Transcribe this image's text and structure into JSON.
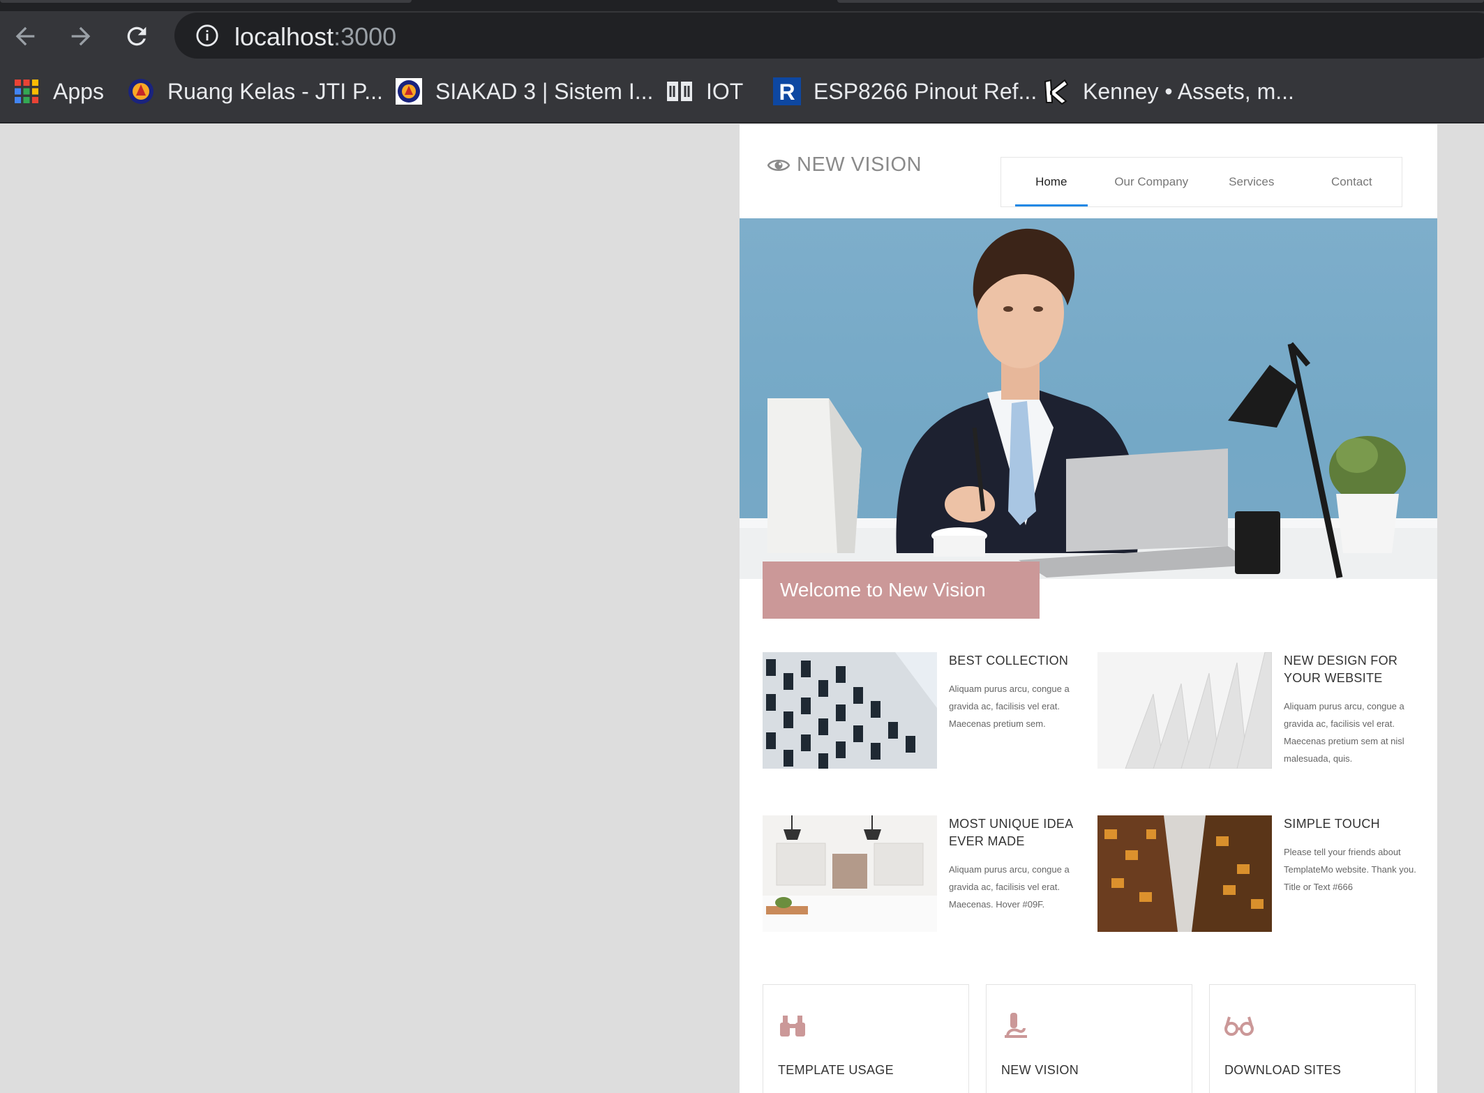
{
  "browser": {
    "url_host": "localhost",
    "url_port": ":3000",
    "bookmarks": [
      {
        "label": "Apps",
        "icon": "apps-grid-icon"
      },
      {
        "label": "Ruang Kelas - JTI P...",
        "icon": "university-emblem-icon"
      },
      {
        "label": "SIAKAD 3 | Sistem I...",
        "icon": "university-emblem-icon"
      },
      {
        "label": "IOT",
        "icon": "book-icon"
      },
      {
        "label": "ESP8266 Pinout Ref...",
        "icon": "r-letter-icon"
      },
      {
        "label": "Kenney • Assets, m...",
        "icon": "kenney-k-icon"
      }
    ]
  },
  "site": {
    "brand": "NEW VISION",
    "nav": [
      {
        "label": "Home",
        "active": true
      },
      {
        "label": "Our Company",
        "active": false
      },
      {
        "label": "Services",
        "active": false
      },
      {
        "label": "Contact",
        "active": false
      }
    ],
    "hero_caption": "Welcome to New Vision",
    "features": [
      {
        "title": "BEST COLLECTION",
        "text": "Aliquam purus arcu, congue a gravida ac, facilisis vel erat. Maecenas pretium sem."
      },
      {
        "title": "NEW DESIGN FOR YOUR WEBSITE",
        "text": "Aliquam purus arcu, congue a gravida ac, facilisis vel erat. Maecenas pretium sem at nisl malesuada, quis."
      },
      {
        "title": "MOST UNIQUE IDEA EVER MADE",
        "text": "Aliquam purus arcu, congue a gravida ac, facilisis vel erat. Maecenas. Hover #09F."
      },
      {
        "title": "SIMPLE TOUCH",
        "text": "Please tell your friends about TemplateMo website. Thank you. Title or Text #666"
      }
    ],
    "cards": [
      {
        "title": "TEMPLATE USAGE",
        "icon": "binoculars-icon"
      },
      {
        "title": "NEW VISION",
        "icon": "microscope-icon"
      },
      {
        "title": "DOWNLOAD SITES",
        "icon": "glasses-icon"
      }
    ],
    "colors": {
      "accent": "#cb9898",
      "nav_underline": "#1e88e5"
    }
  }
}
